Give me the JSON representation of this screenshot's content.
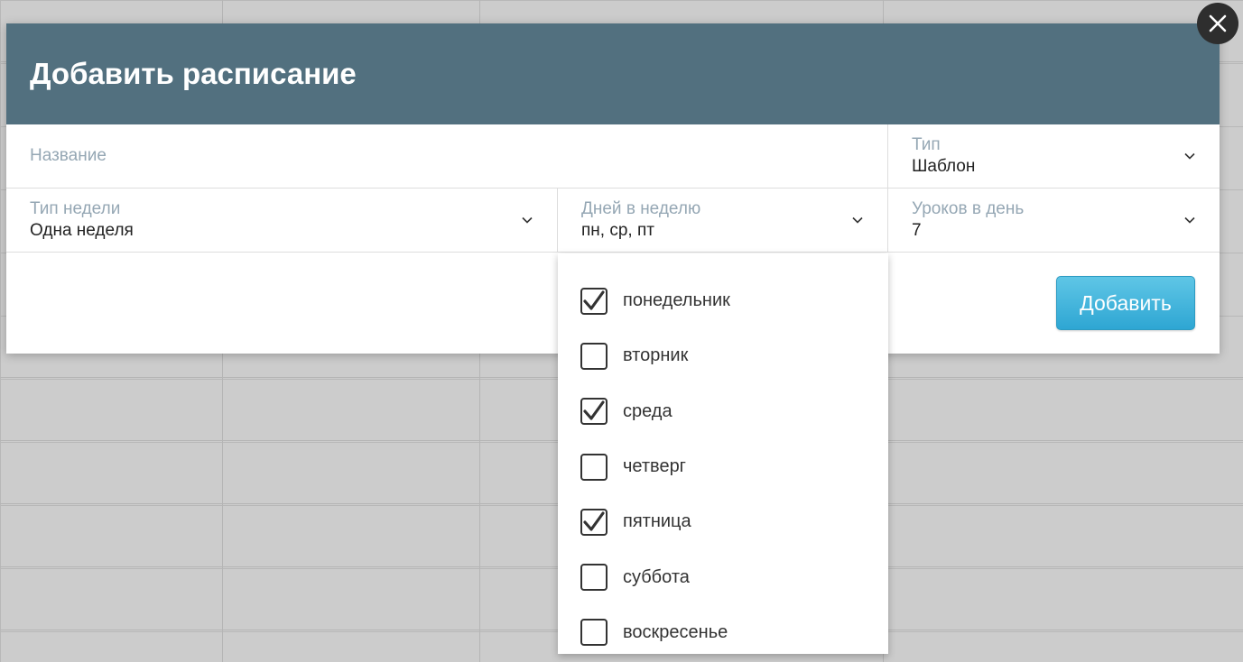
{
  "modal": {
    "title": "Добавить расписание",
    "name_field": {
      "placeholder": "Название",
      "value": ""
    },
    "type_field": {
      "label": "Тип",
      "value": "Шаблон"
    },
    "week_type_field": {
      "label": "Тип недели",
      "value": "Одна неделя"
    },
    "days_field": {
      "label": "Дней в неделю",
      "value": "пн, ср, пт"
    },
    "lessons_field": {
      "label": "Уроков в день",
      "value": "7"
    },
    "add_button_label": "Добавить",
    "close_icon": "close-icon",
    "chevron_icon": "chevron-down-icon"
  },
  "days_dropdown": {
    "items": [
      {
        "label": "понедельник",
        "checked": true
      },
      {
        "label": "вторник",
        "checked": false
      },
      {
        "label": "среда",
        "checked": true
      },
      {
        "label": "четверг",
        "checked": false
      },
      {
        "label": "пятница",
        "checked": true
      },
      {
        "label": "суббота",
        "checked": false
      },
      {
        "label": "воскресенье",
        "checked": false
      }
    ]
  },
  "colors": {
    "header_bg": "#52707f",
    "label_color": "#95a7b4",
    "button_accent": "#2ea6d3",
    "backdrop": "#cccccc"
  }
}
